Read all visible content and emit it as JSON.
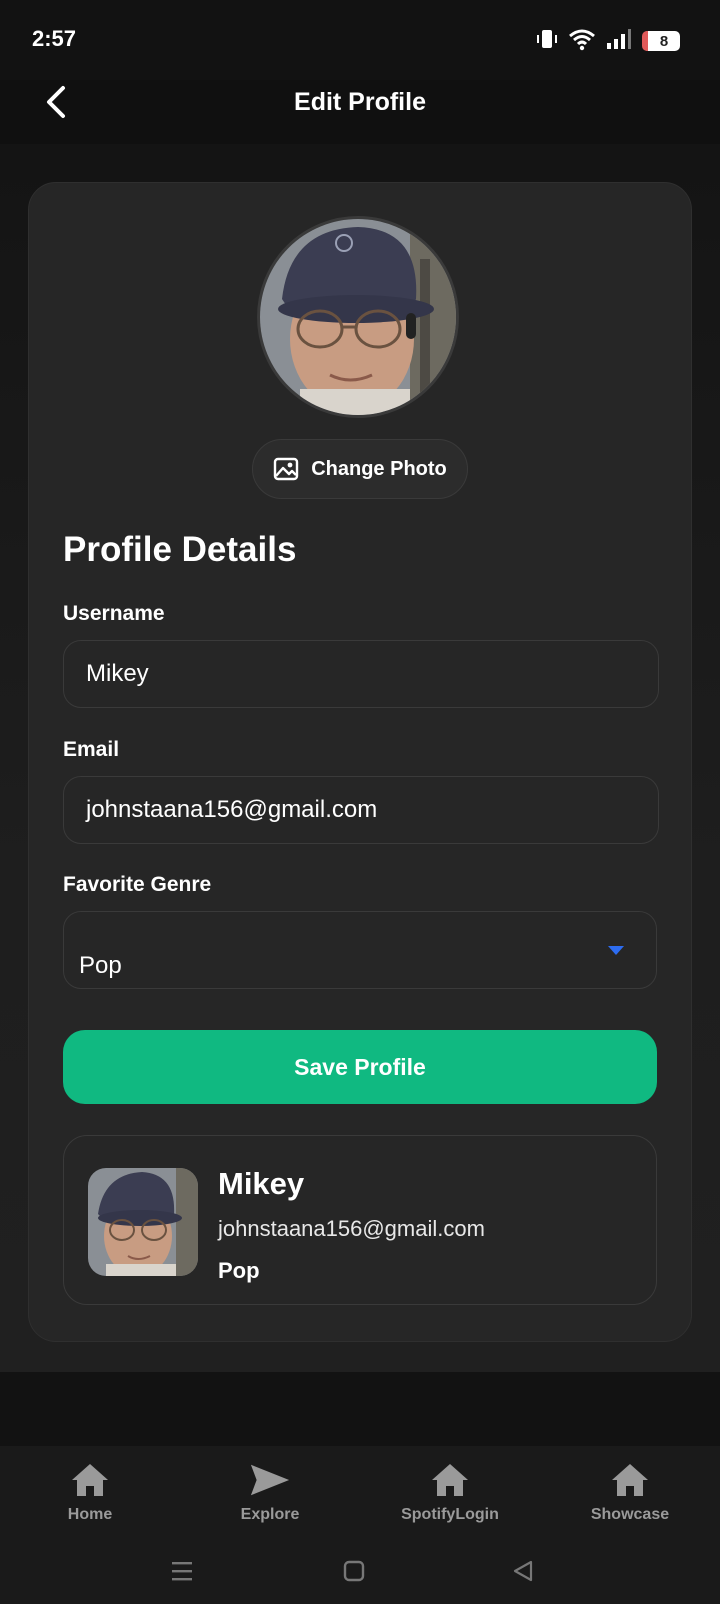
{
  "status_bar": {
    "time": "2:57",
    "battery": "8"
  },
  "header": {
    "title": "Edit Profile",
    "back_icon": "chevron-left-icon"
  },
  "profile": {
    "change_photo_label": "Change Photo",
    "change_photo_icon": "image-icon"
  },
  "form": {
    "section_title": "Profile Details",
    "username_label": "Username",
    "username_value": "Mikey",
    "email_label": "Email",
    "email_value": "johnstaana156@gmail.com",
    "genre_label": "Favorite Genre",
    "genre_value": "Pop",
    "save_label": "Save Profile"
  },
  "preview": {
    "name": "Mikey",
    "email": "johnstaana156@gmail.com",
    "genre": "Pop"
  },
  "bottom_nav": {
    "items": [
      {
        "label": "Home",
        "icon": "home-icon"
      },
      {
        "label": "Explore",
        "icon": "send-icon"
      },
      {
        "label": "SpotifyLogin",
        "icon": "home-icon"
      },
      {
        "label": "Showcase",
        "icon": "home-icon"
      }
    ]
  },
  "colors": {
    "accent": "#10b981",
    "dropdown_arrow": "#2d6cf0",
    "card": "#262626",
    "background": "#101010"
  }
}
